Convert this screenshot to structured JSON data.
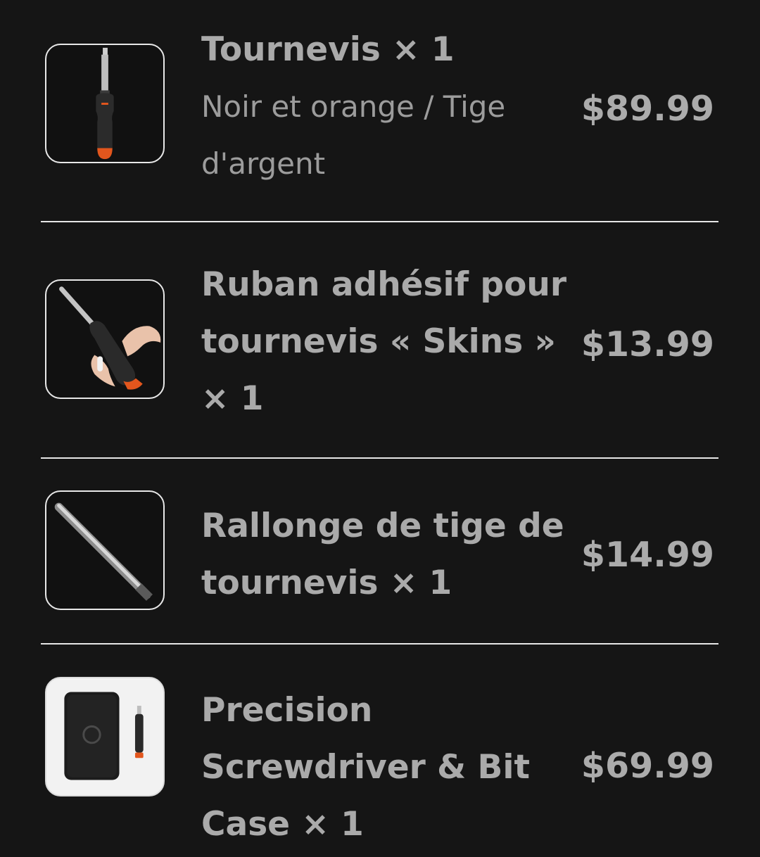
{
  "items": [
    {
      "title": "Tournevis × 1",
      "variant": "Noir et orange / Tige d'argent",
      "price": "$89.99",
      "image": "screwdriver-icon"
    },
    {
      "title": "Ruban adhésif pour tournevis « Skins » × 1",
      "price": "$13.99",
      "image": "screwdriver-skin-tape-icon"
    },
    {
      "title": "Rallonge de tige de tournevis × 1",
      "price": "$14.99",
      "image": "shaft-extension-icon"
    },
    {
      "title": "Precision Screwdriver & Bit Case × 1",
      "price": "$69.99",
      "image": "bit-case-icon"
    }
  ],
  "colors": {
    "background": "#151515",
    "text": "#aaaaaa",
    "accent_orange": "#e2561d",
    "divider": "#e6e6e6"
  }
}
